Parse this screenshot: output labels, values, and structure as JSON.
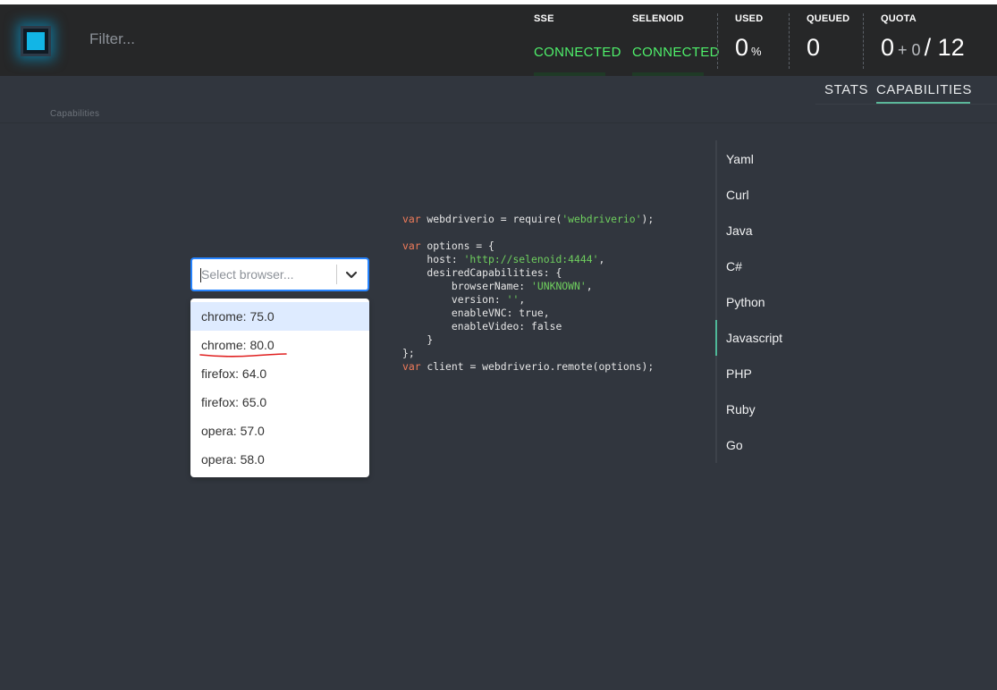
{
  "header": {
    "filter_placeholder": "Filter...",
    "sse": {
      "label": "SSE",
      "status": "CONNECTED"
    },
    "selenoid": {
      "label": "SELENOID",
      "status": "CONNECTED"
    },
    "used": {
      "label": "USED",
      "value": "0",
      "unit": "%"
    },
    "queued": {
      "label": "QUEUED",
      "value": "0"
    },
    "quota": {
      "label": "QUOTA",
      "used": "0",
      "plus": "+ 0",
      "total": "/ 12"
    },
    "status_color": "#4ff06b",
    "logo_color": "#12b5e6"
  },
  "tabs": [
    {
      "label": "STATS",
      "active": false
    },
    {
      "label": "CAPABILITIES",
      "active": true
    }
  ],
  "breadcrumb": "Capabilities",
  "browser_select": {
    "placeholder": "Select browser...",
    "options": [
      "chrome: 75.0",
      "chrome: 80.0",
      "firefox: 64.0",
      "firefox: 65.0",
      "opera: 57.0",
      "opera: 58.0"
    ],
    "focused_option": "chrome: 75.0"
  },
  "code": {
    "language": "Javascript",
    "tokens": {
      "var": "var",
      "l1_a": " webdriverio = require(",
      "l1_str": "'webdriverio'",
      "l1_b": ");",
      "l3_a": " options = {",
      "l4_a": "    host: ",
      "l4_str": "'http://selenoid:4444'",
      "l4_b": ",",
      "l5": "    desiredCapabilities: {",
      "l6_a": "        browserName: ",
      "l6_str": "'UNKNOWN'",
      "l6_b": ",",
      "l7_a": "        version: ",
      "l7_str": "''",
      "l7_b": ",",
      "l8": "        enableVNC: true,",
      "l9": "        enableVideo: false",
      "l10": "    }",
      "l11": "};",
      "l12_a": " client = webdriverio.remote(options);"
    }
  },
  "languages": [
    "Yaml",
    "Curl",
    "Java",
    "C#",
    "Python",
    "Javascript",
    "PHP",
    "Ruby",
    "Go"
  ],
  "active_language": "Javascript",
  "accent_color": "#5bb89a"
}
